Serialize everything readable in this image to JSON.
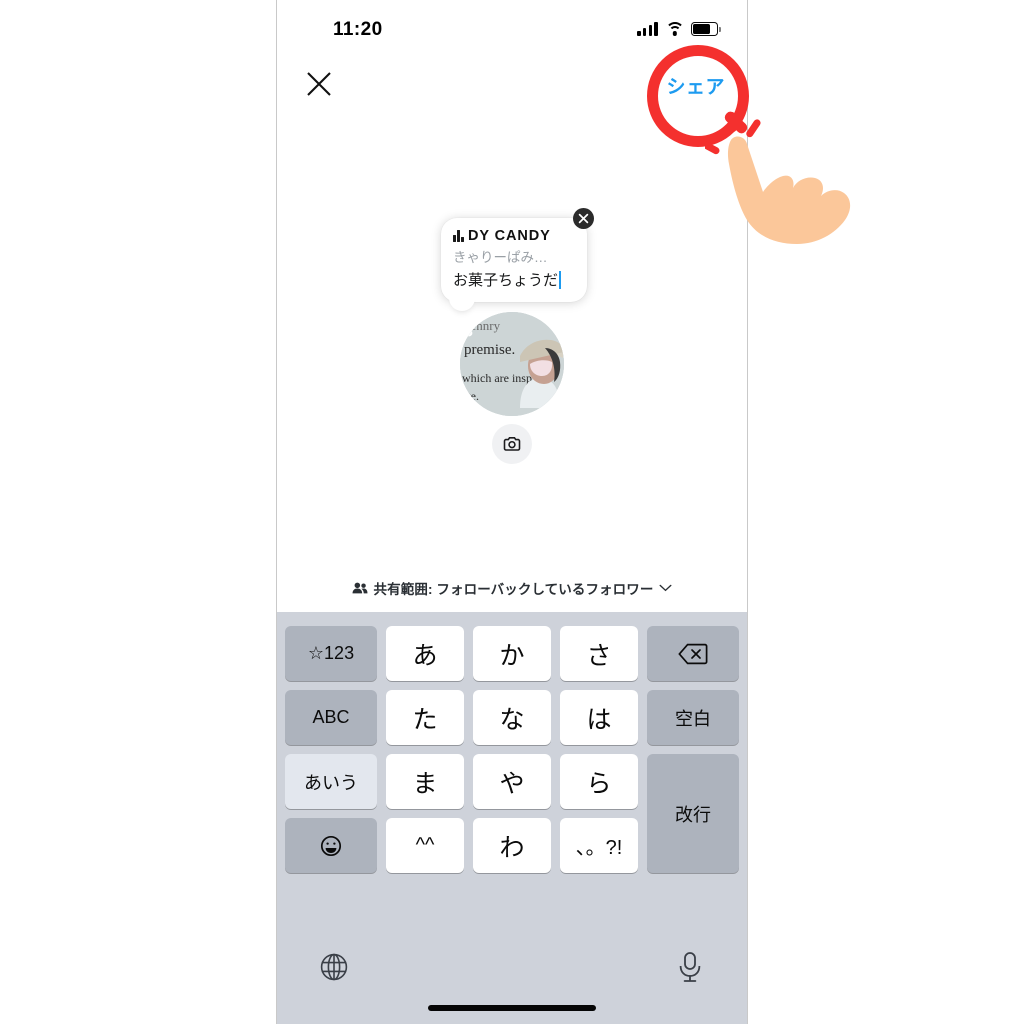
{
  "status_bar": {
    "time": "11:20",
    "signal_icon": "cellular-signal-icon",
    "wifi_icon": "wifi-icon",
    "battery_icon": "battery-icon"
  },
  "nav": {
    "close_icon": "close-x-icon",
    "share_label": "シェア"
  },
  "music_card": {
    "eq_icon": "music-equalizer-icon",
    "title": "DY  CANDY",
    "artist": "きゃりーぱみ…",
    "input_value": "お菓子ちょうだ",
    "close_icon": "card-close-icon"
  },
  "avatar": {
    "name": "profile-avatar"
  },
  "camera": {
    "icon": "camera-icon"
  },
  "audience": {
    "people_icon": "people-icon",
    "label": "共有範囲: フォローバックしているフォロワー",
    "chevron_icon": "chevron-down-icon"
  },
  "keyboard": {
    "rows": [
      [
        "☆123",
        "あ",
        "か",
        "さ",
        "⌫"
      ],
      [
        "ABC",
        "た",
        "な",
        "は",
        "空白"
      ],
      [
        "あいう",
        "ま",
        "や",
        "ら",
        "改行"
      ],
      [
        "☺",
        "^^",
        "わ",
        "、。?!"
      ]
    ],
    "keys": {
      "symbols": "☆123",
      "abc": "ABC",
      "kana": "あいう",
      "emoji": "☺",
      "delete": "delete-key",
      "space": "空白",
      "enter": "改行",
      "a": "あ",
      "ka": "か",
      "sa": "さ",
      "ta": "た",
      "na": "な",
      "ha": "は",
      "ma": "ま",
      "ya": "や",
      "ra": "ら",
      "kaomoji": "^^",
      "wa": "わ",
      "punct": "、。?!"
    },
    "globe_icon": "globe-icon",
    "mic_icon": "microphone-icon"
  },
  "annotation": {
    "circle_color": "#f4302e",
    "hand_color": "#fbc79a",
    "pointer_icon": "pointing-hand-icon",
    "target": "シェア"
  },
  "colors": {
    "accent_blue": "#1d9bf0",
    "annotation_red": "#f4302e",
    "keyboard_bg": "#ced2da",
    "key_fn_bg": "#adb3bd"
  }
}
